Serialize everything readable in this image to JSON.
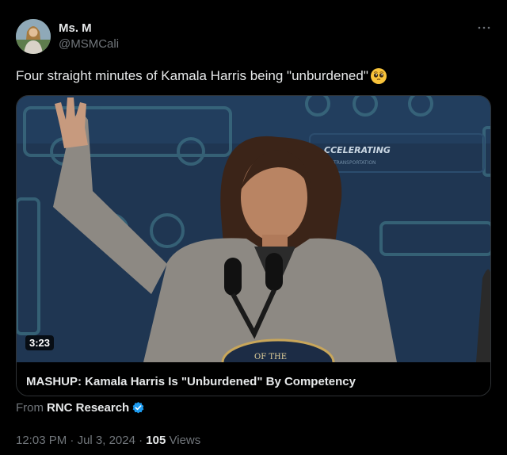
{
  "author": {
    "display_name": "Ms. M",
    "handle": "@MSMCali"
  },
  "more_icon": "more-horizontal-icon",
  "tweet_text": "Four straight minutes of Kamala Harris being \"unburdened\"",
  "emoji": "pleading-face-emoji",
  "card": {
    "duration": "3:23",
    "title": "MASHUP: Kamala Harris Is \"Unburdened\" By Competency",
    "background_text": "ACCELERATING TRANSPORTATION"
  },
  "source": {
    "prefix": "From",
    "name": "RNC Research",
    "verified_icon": "verified-badge-icon"
  },
  "meta": {
    "time": "12:03 PM",
    "date": "Jul 3, 2024",
    "separator": "·",
    "views_count": "105",
    "views_label": "Views"
  },
  "colors": {
    "background": "#000000",
    "text_primary": "#e7e9ea",
    "text_secondary": "#71767b",
    "border": "#2f3336",
    "verified_blue": "#1d9bf0"
  }
}
